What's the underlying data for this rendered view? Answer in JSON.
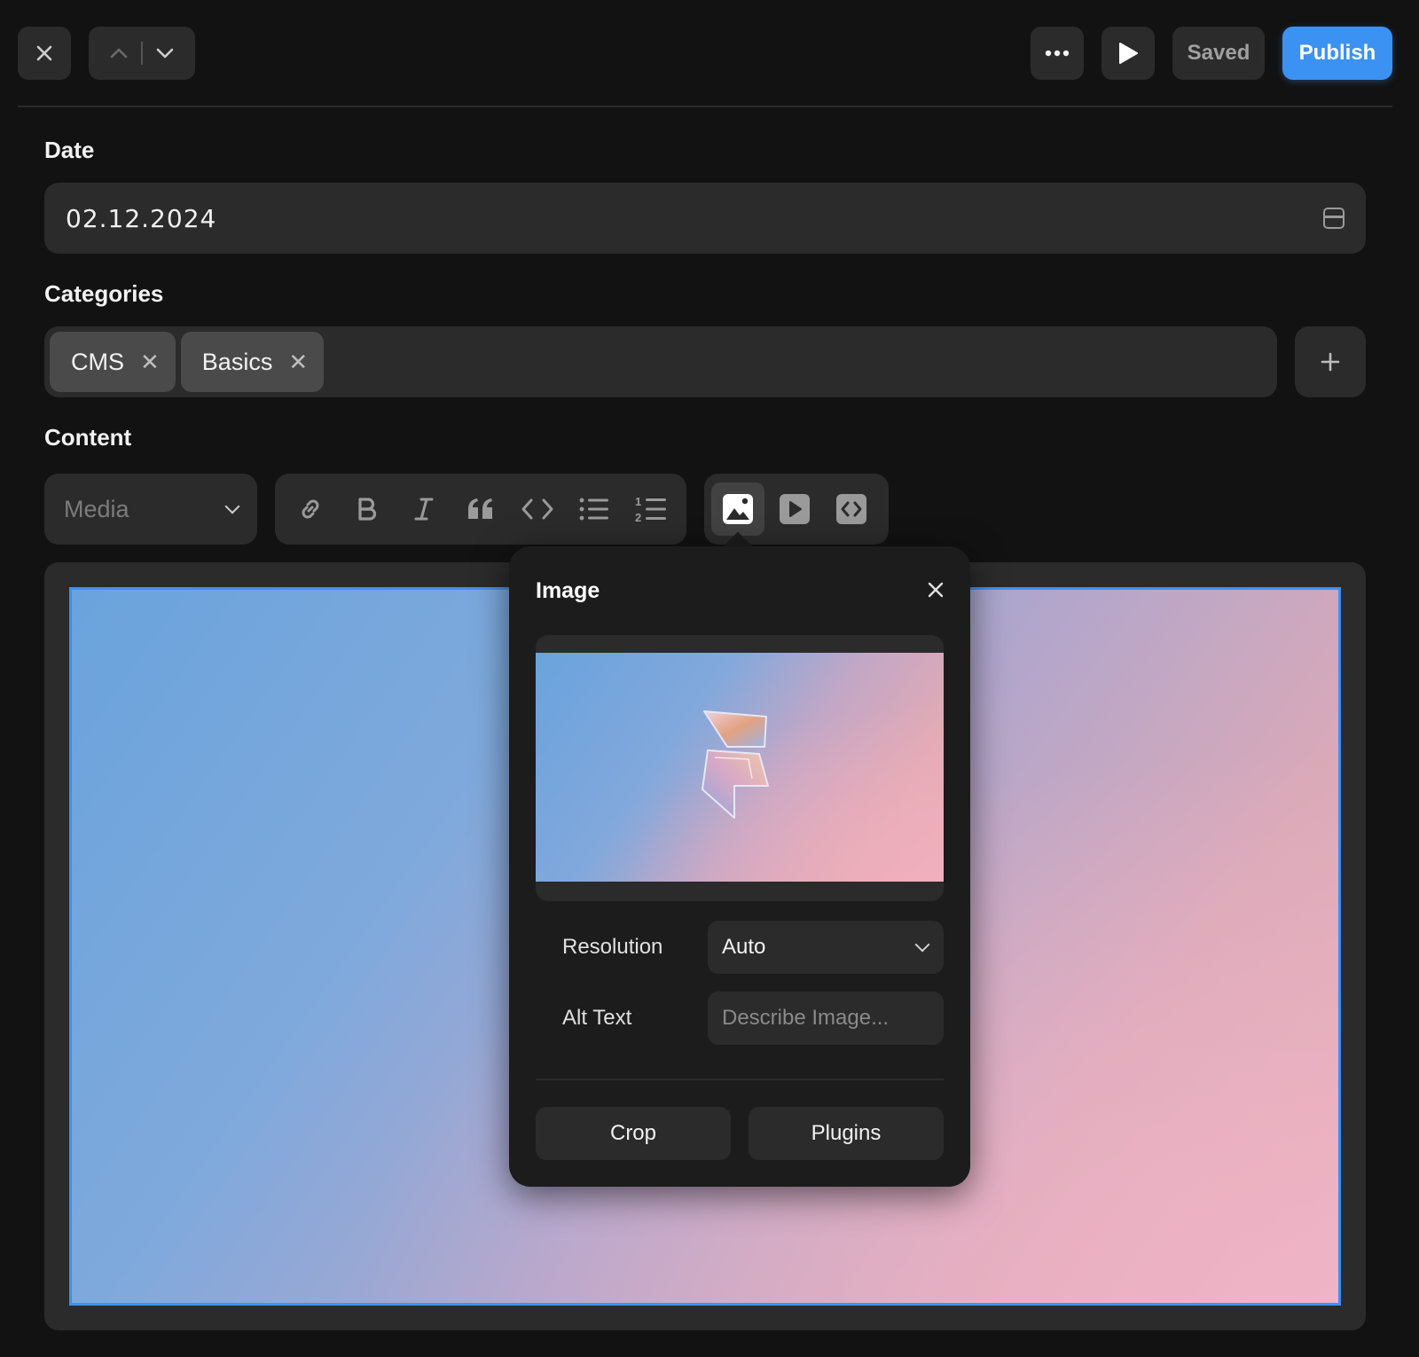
{
  "toolbar": {
    "saved_label": "Saved",
    "publish_label": "Publish"
  },
  "fields": {
    "date": {
      "label": "Date",
      "value": "02.12.2024"
    },
    "categories": {
      "label": "Categories",
      "tags": [
        {
          "label": "CMS"
        },
        {
          "label": "Basics"
        }
      ]
    },
    "content": {
      "label": "Content",
      "block_type": "Media"
    }
  },
  "image_popover": {
    "title": "Image",
    "resolution_label": "Resolution",
    "resolution_value": "Auto",
    "alt_label": "Alt Text",
    "alt_placeholder": "Describe Image...",
    "crop_label": "Crop",
    "plugins_label": "Plugins"
  },
  "colors": {
    "accent": "#3c92f2",
    "background": "#121212",
    "surface": "#2b2b2b",
    "chip": "#4a4a4a"
  },
  "icons": {
    "close": "close-icon",
    "nav_up": "chevron-up-icon",
    "nav_down": "chevron-down-icon",
    "more": "more-icon",
    "play": "play-icon",
    "calendar": "calendar-icon",
    "add": "plus-icon",
    "format": [
      "link-icon",
      "bold-icon",
      "italic-icon",
      "quote-icon",
      "code-icon",
      "bullet-list-icon",
      "numbered-list-icon"
    ],
    "insert": [
      "image-icon",
      "video-icon",
      "embed-icon"
    ]
  }
}
